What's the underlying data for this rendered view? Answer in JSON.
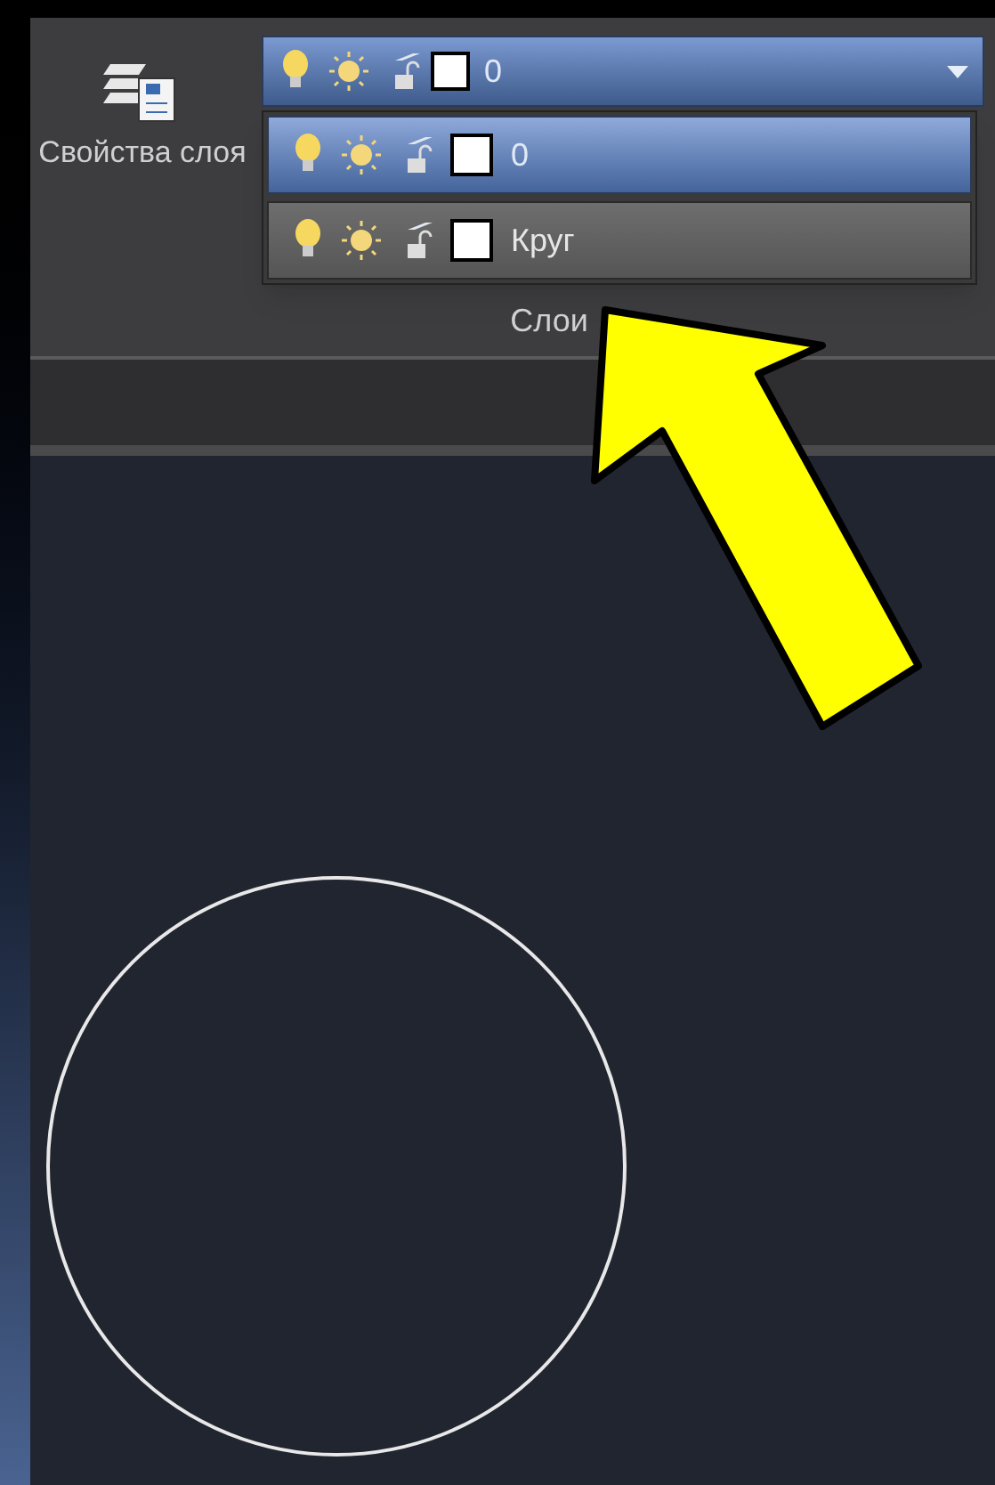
{
  "ribbon": {
    "properties_button": {
      "label": "Свойства слоя"
    },
    "current_layer": {
      "name": "0",
      "color": "#ffffff"
    },
    "layers": [
      {
        "name": "0",
        "color": "#ffffff",
        "selected": true
      },
      {
        "name": "Круг",
        "color": "#ffffff",
        "selected": false
      }
    ],
    "panel_title": "Слои"
  }
}
